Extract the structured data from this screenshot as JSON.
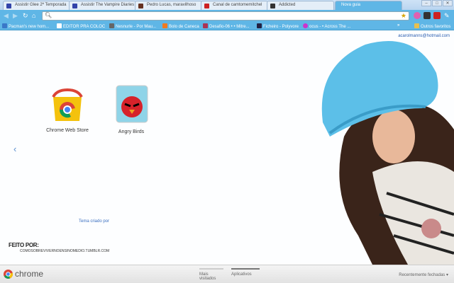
{
  "tabs": [
    {
      "label": "Assistir Glee 2ª Temporada",
      "color": "#3344aa"
    },
    {
      "label": "Assistir The Vampire Diaries",
      "color": "#3344aa"
    },
    {
      "label": "Pedro Lucas, maravilhoso",
      "color": "#663322"
    },
    {
      "label": "Canal de camtomemitchel",
      "color": "#cc2222"
    },
    {
      "label": "Addicted",
      "color": "#333333"
    },
    {
      "label": "Nova guia",
      "color": "#5fb6e6",
      "active": true
    }
  ],
  "window_controls": [
    "–",
    "□",
    "✕"
  ],
  "omnibox": {
    "value": ""
  },
  "bookmarks": [
    {
      "label": "Pacman's new hom...",
      "color": "#3a78c8"
    },
    {
      "label": "EDITOR PRA COLOC",
      "color": "#ffffff"
    },
    {
      "label": "Nesnurle - Por Mau...",
      "color": "#666666"
    },
    {
      "label": "Bolo de Caneca",
      "color": "#f07a20"
    },
    {
      "label": "Desafio-06 • • Mitre...",
      "color": "#aa3355"
    },
    {
      "label": "Ficheiro - Polyvore",
      "color": "#222244"
    },
    {
      "label": "ocus - • Across The ...",
      "color": "#cc33cc"
    }
  ],
  "bookmarks_overflow": "»",
  "other_bookmarks": "Outros favoritos",
  "user_email": "acarolmanns@hotmail.com",
  "apps": [
    {
      "label": "Chrome Web Store"
    },
    {
      "label": "Angry Birds"
    }
  ],
  "theme_credit": "Tema criado por",
  "made_by": "FEITO POR:",
  "made_by_url": "COMOSOBREVIVERNOENSINOMEDIO.TUMBLR.COM",
  "footer": {
    "brand": "chrome",
    "tabs": [
      "Mais visitados",
      "Aplicativos"
    ],
    "selected_tab": 1,
    "recently_closed": "Recentemente fechadas ▾"
  },
  "accent": "#5fb6e6"
}
